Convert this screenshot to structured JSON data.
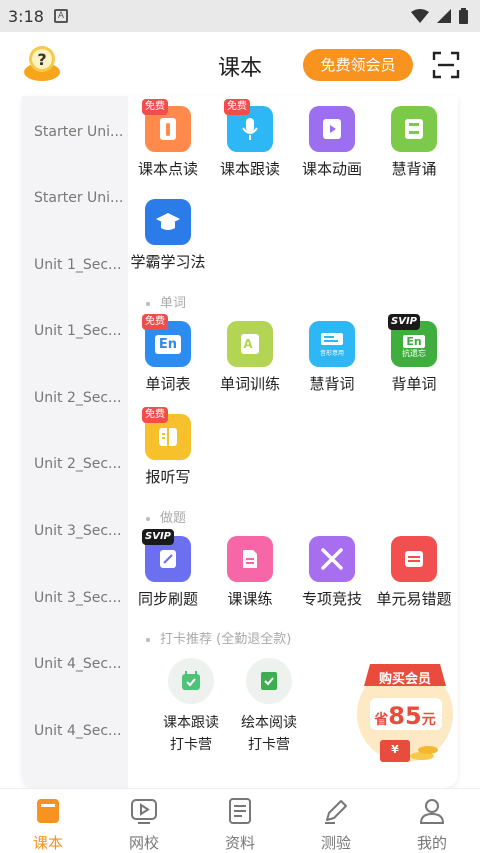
{
  "status": {
    "time": "3:18"
  },
  "header": {
    "title": "课本",
    "vip_button": "免费领会员"
  },
  "sidebar": {
    "units": [
      "Starter Uni...",
      "Starter Uni...",
      "Unit 1_Sec...",
      "Unit 1_Sec...",
      "Unit 2_Sec...",
      "Unit 2_Sec...",
      "Unit 3_Sec...",
      "Unit 3_Sec...",
      "Unit 4_Sec...",
      "Unit 4_Sec..."
    ]
  },
  "tags": {
    "free": "免费",
    "svip": "SVIP"
  },
  "reading": {
    "items": [
      {
        "label": "课本点读",
        "tag": "free"
      },
      {
        "label": "课本跟读",
        "tag": "free"
      },
      {
        "label": "课本动画"
      },
      {
        "label": "慧背诵"
      },
      {
        "label": "学霸学习法"
      }
    ]
  },
  "words": {
    "title": "单词",
    "items": [
      {
        "label": "单词表",
        "tag": "free",
        "icon_text": "En"
      },
      {
        "label": "单词训练"
      },
      {
        "label": "慧背词",
        "icon_text": "音形意用"
      },
      {
        "label": "背单词",
        "tag": "svip",
        "icon_text": "En",
        "icon_sub": "抗遗忘"
      },
      {
        "label": "报听写",
        "tag": "free"
      }
    ]
  },
  "exercises": {
    "title": "做题",
    "items": [
      {
        "label": "同步刷题",
        "tag": "svip"
      },
      {
        "label": "课课练"
      },
      {
        "label": "专项竞技"
      },
      {
        "label": "单元易错题"
      }
    ]
  },
  "checkin": {
    "title": "打卡推荐 (全勤退全款)",
    "items": [
      {
        "line1": "课本跟读",
        "line2": "打卡营"
      },
      {
        "line1": "绘本阅读",
        "line2": "打卡营"
      }
    ]
  },
  "promo": {
    "badge": "购买会员",
    "prefix": "省",
    "amount": "85",
    "unit": "元",
    "symbol": "¥"
  },
  "tabbar": {
    "tabs": [
      {
        "label": "课本"
      },
      {
        "label": "网校"
      },
      {
        "label": "资料"
      },
      {
        "label": "测验"
      },
      {
        "label": "我的"
      }
    ]
  },
  "colors": {
    "accent": "#f7931e",
    "red": "#f24d4d",
    "blue": "#2d8cf0"
  }
}
